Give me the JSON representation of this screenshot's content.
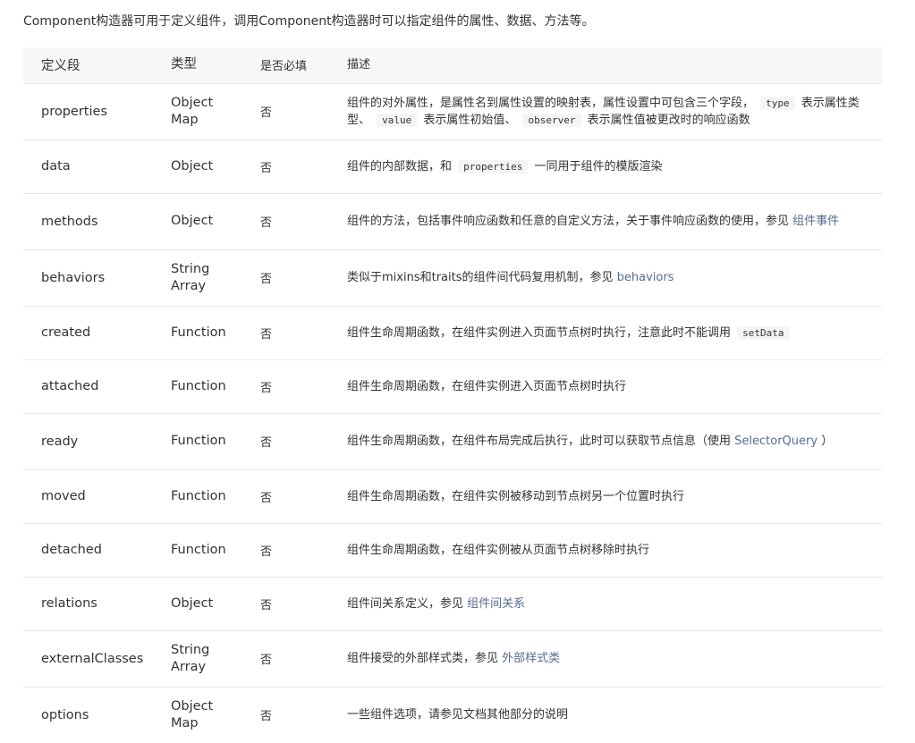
{
  "intro": "Component构造器可用于定义组件，调用Component构造器时可以指定组件的属性、数据、方法等。",
  "headers": [
    "定义段",
    "类型",
    "是否必填",
    "描述"
  ],
  "rows": [
    {
      "name": "properties",
      "type": "Object Map",
      "required": "否",
      "desc": [
        {
          "t": "组件的对外属性，是属性名到属性设置的映射表，属性设置中可包含三个字段， "
        },
        {
          "c": "type"
        },
        {
          "t": " 表示属性类型、 "
        },
        {
          "c": "value"
        },
        {
          "t": " 表示属性初始值、 "
        },
        {
          "c": "observer"
        },
        {
          "t": " 表示属性值被更改时的响应函数"
        }
      ]
    },
    {
      "name": "data",
      "type": "Object",
      "required": "否",
      "desc": [
        {
          "t": "组件的内部数据，和 "
        },
        {
          "c": "properties"
        },
        {
          "t": " 一同用于组件的模版渲染"
        }
      ]
    },
    {
      "name": "methods",
      "type": "Object",
      "required": "否",
      "desc": [
        {
          "t": "组件的方法，包括事件响应函数和任意的自定义方法，关于事件响应函数的使用，参见 "
        },
        {
          "l": "组件事件"
        }
      ]
    },
    {
      "name": "behaviors",
      "type": "String Array",
      "required": "否",
      "desc": [
        {
          "t": "类似于mixins和traits的组件间代码复用机制，参见 "
        },
        {
          "l": "behaviors"
        }
      ]
    },
    {
      "name": "created",
      "type": "Function",
      "required": "否",
      "desc": [
        {
          "t": "组件生命周期函数，在组件实例进入页面节点树时执行，注意此时不能调用 "
        },
        {
          "c": "setData"
        }
      ]
    },
    {
      "name": "attached",
      "type": "Function",
      "required": "否",
      "desc": [
        {
          "t": "组件生命周期函数，在组件实例进入页面节点树时执行"
        }
      ]
    },
    {
      "name": "ready",
      "type": "Function",
      "required": "否",
      "desc": [
        {
          "t": "组件生命周期函数，在组件布局完成后执行，此时可以获取节点信息（使用 "
        },
        {
          "l": "SelectorQuery"
        },
        {
          "t": " ）"
        }
      ]
    },
    {
      "name": "moved",
      "type": "Function",
      "required": "否",
      "desc": [
        {
          "t": "组件生命周期函数，在组件实例被移动到节点树另一个位置时执行"
        }
      ]
    },
    {
      "name": "detached",
      "type": "Function",
      "required": "否",
      "desc": [
        {
          "t": "组件生命周期函数，在组件实例被从页面节点树移除时执行"
        }
      ]
    },
    {
      "name": "relations",
      "type": "Object",
      "required": "否",
      "desc": [
        {
          "t": "组件间关系定义，参见 "
        },
        {
          "l": "组件间关系"
        }
      ]
    },
    {
      "name": "externalClasses",
      "type": "String Array",
      "required": "否",
      "desc": [
        {
          "t": "组件接受的外部样式类，参见 "
        },
        {
          "l": "外部样式类"
        }
      ]
    },
    {
      "name": "options",
      "type": "Object Map",
      "required": "否",
      "desc": [
        {
          "t": "一些组件选项，请参见文档其他部分的说明"
        }
      ]
    }
  ]
}
